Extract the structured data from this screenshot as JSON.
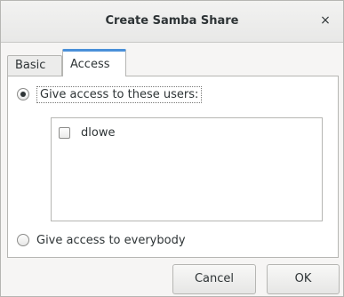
{
  "window": {
    "title": "Create Samba Share",
    "close_glyph": "×"
  },
  "tabs": [
    {
      "label": "Basic",
      "active": false
    },
    {
      "label": "Access",
      "active": true
    }
  ],
  "access": {
    "option_users_label": "Give access to these users:",
    "option_users_selected": true,
    "users": [
      {
        "name": "dlowe",
        "checked": false
      }
    ],
    "option_everybody_label": "Give access to everybody",
    "option_everybody_selected": false
  },
  "buttons": {
    "cancel_label": "Cancel",
    "ok_label": "OK"
  }
}
